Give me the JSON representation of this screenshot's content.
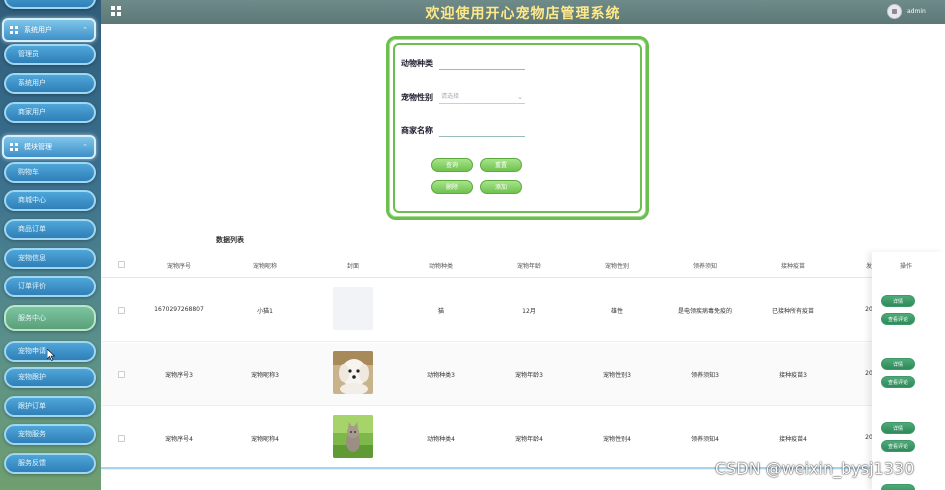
{
  "header": {
    "title": "欢迎使用开心宠物店管理系统",
    "user": "admin"
  },
  "sidebar": {
    "groups": [
      {
        "label": "系统用户"
      },
      {
        "label": "模块管理"
      }
    ],
    "items": [
      {
        "label": "管理员"
      },
      {
        "label": "系统用户"
      },
      {
        "label": "商家用户"
      },
      {
        "label": "购物车"
      },
      {
        "label": "商城中心"
      },
      {
        "label": "商品订单"
      },
      {
        "label": "宠物信息"
      },
      {
        "label": "订单评价"
      },
      {
        "label": "服务中心"
      },
      {
        "label": "宠物申请"
      },
      {
        "label": "宠物跟护"
      },
      {
        "label": "跟护订单"
      },
      {
        "label": "宠物服务"
      },
      {
        "label": "服务反馈"
      }
    ]
  },
  "search": {
    "species_label": "动物种类",
    "gender_label": "宠物性别",
    "gender_placeholder": "请选择",
    "merchant_label": "商家名称",
    "query_btn": "查询",
    "reset_btn": "重置",
    "delete_btn": "删除",
    "add_btn": "添加"
  },
  "table": {
    "title": "数据列表",
    "columns": [
      "宠物序号",
      "宠物昵称",
      "封面",
      "动物种类",
      "宠物年龄",
      "宠物性别",
      "领养须知",
      "接种疫苗",
      "发",
      "操作"
    ],
    "rows": [
      {
        "id": "1670297268807",
        "name": "小猫1",
        "species": "猫",
        "age": "12月",
        "gender": "雄性",
        "notice": "是电领疾病毒免疫的",
        "vaccine": "已接种所有疫苗",
        "cut": "20"
      },
      {
        "id": "宠物序号3",
        "name": "宠物昵称3",
        "species": "动物种类3",
        "age": "宠物年龄3",
        "gender": "宠物性别3",
        "notice": "领养须知3",
        "vaccine": "接种疫苗3",
        "cut": "20"
      },
      {
        "id": "宠物序号4",
        "name": "宠物昵称4",
        "species": "动物种类4",
        "age": "宠物年龄4",
        "gender": "宠物性别4",
        "notice": "领养须知4",
        "vaccine": "接种疫苗4",
        "cut": "20"
      }
    ],
    "op_detail": "详情",
    "op_review": "查看评论"
  },
  "watermark": "CSDN @weixin_bysj1330",
  "colors": {
    "header_bg": "#5c7776",
    "title": "#ffe98a",
    "accent_green": "#6cbf4f",
    "sidebar_blue": "#2f7fb8"
  }
}
